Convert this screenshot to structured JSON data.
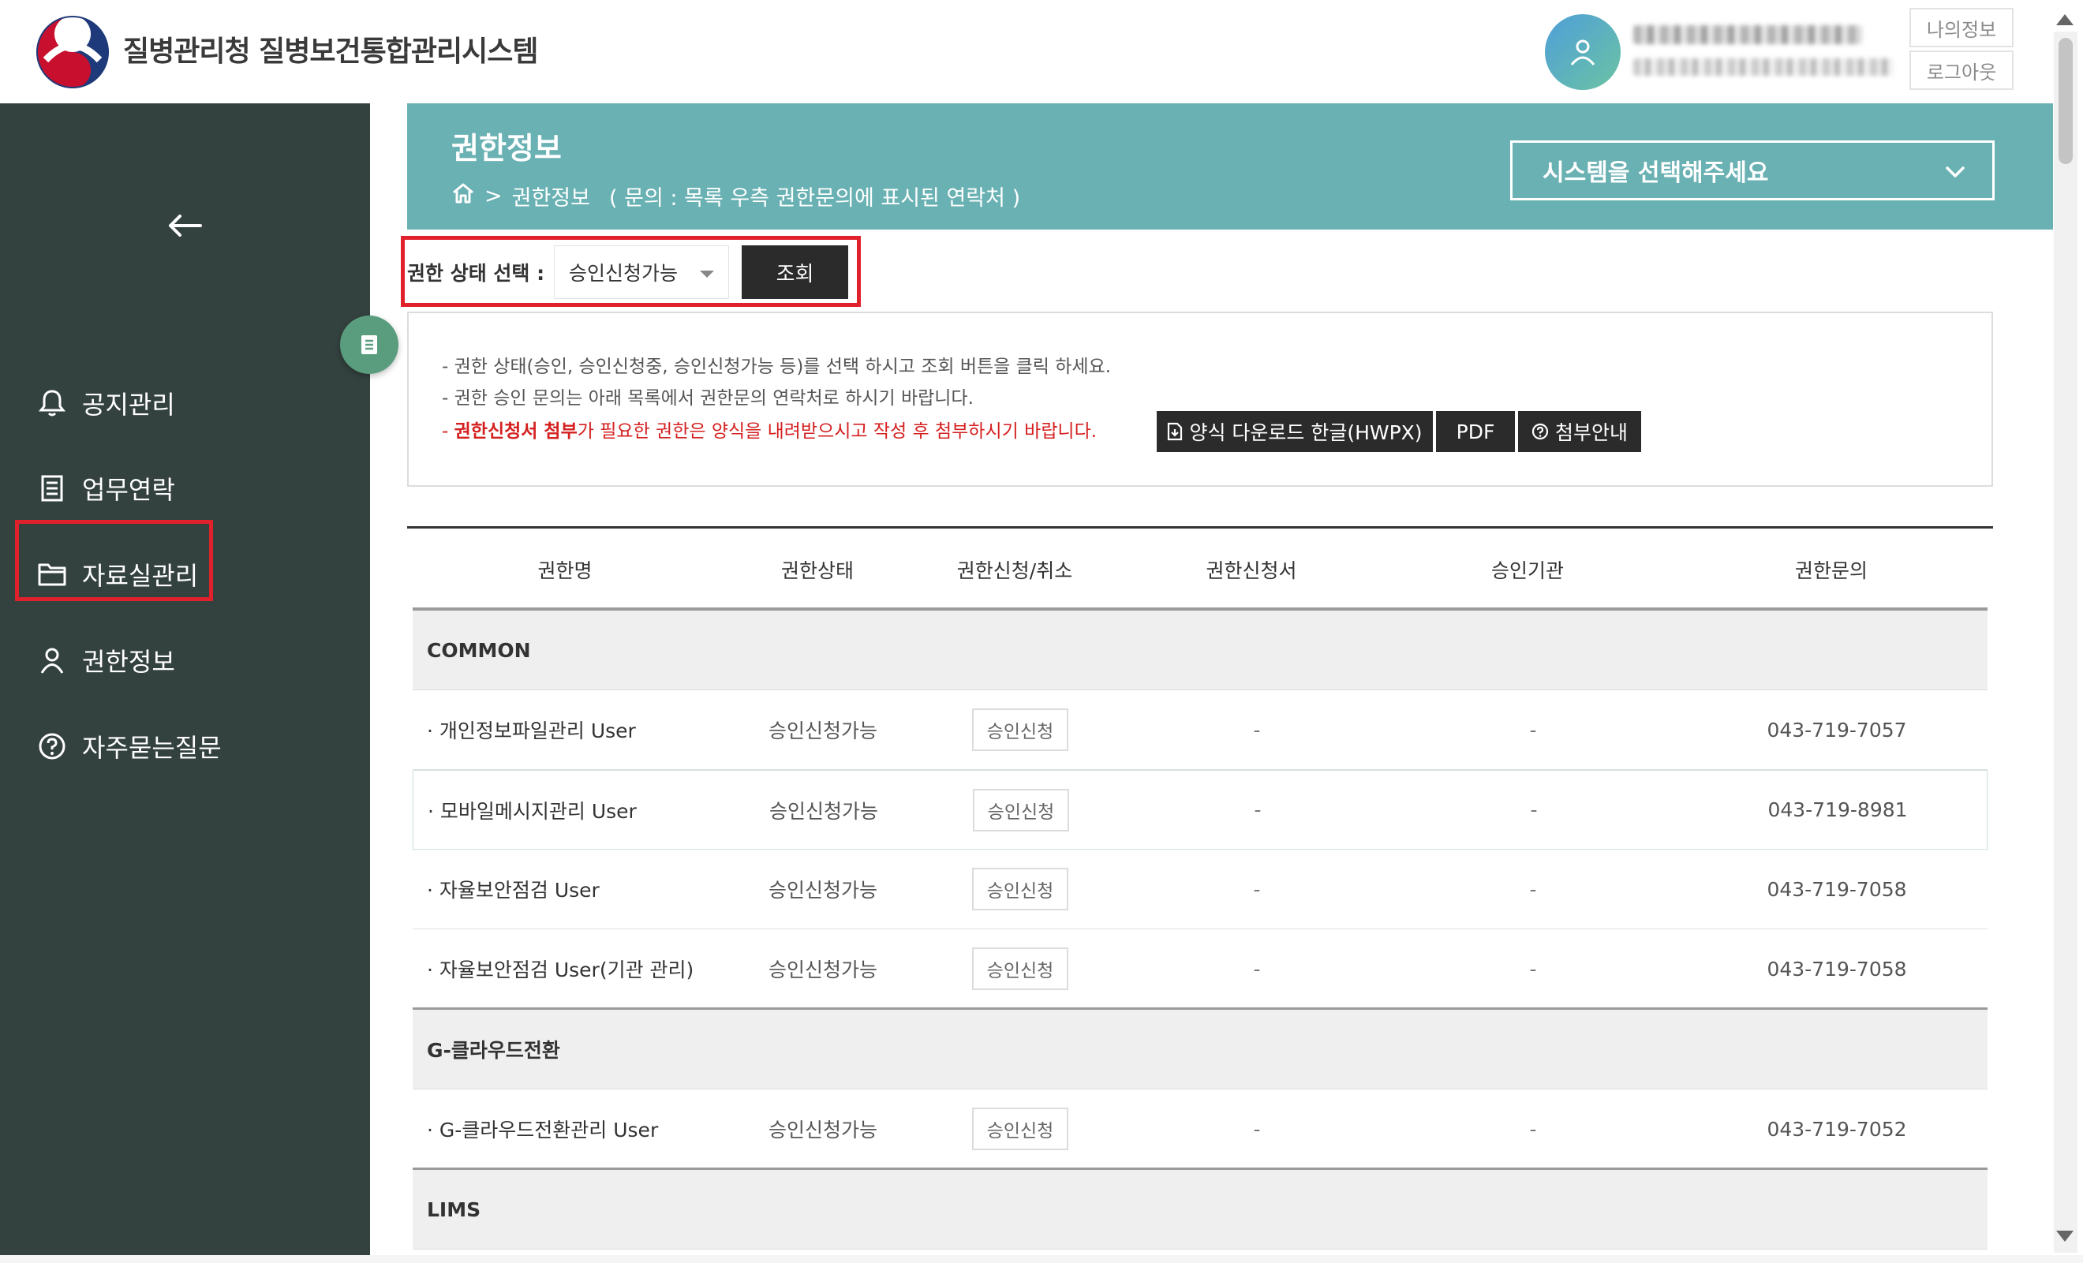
{
  "header": {
    "app_title": "질병관리청 질병보건통합관리시스템",
    "my_info_label": "나의정보",
    "logout_label": "로그아웃"
  },
  "sidebar": {
    "items": [
      {
        "label": "공지관리",
        "icon": "bell-icon"
      },
      {
        "label": "업무연락",
        "icon": "document-icon"
      },
      {
        "label": "자료실관리",
        "icon": "folder-icon"
      },
      {
        "label": "권한정보",
        "icon": "person-icon"
      },
      {
        "label": "자주묻는질문",
        "icon": "question-circle-icon"
      }
    ],
    "active_index": 3
  },
  "banner": {
    "title": "권한정보",
    "breadcrumb_sep": ">",
    "breadcrumb_current": "권한정보",
    "breadcrumb_note": "( 문의 : 목록 우측 권한문의에 표시된 연락처 )",
    "system_select_placeholder": "시스템을 선택해주세요"
  },
  "filter": {
    "label": "권한 상태 선택 :",
    "selected": "승인신청가능",
    "search_label": "조회"
  },
  "info": {
    "line1": "- 권한 상태(승인, 승인신청중, 승인신청가능 등)를 선택 하시고 조회 버튼을 클릭 하세요.",
    "line2": "- 권한 승인 문의는 아래 목록에서 권한문의 연락처로 하시기 바랍니다.",
    "line3_prefix": "- ",
    "line3_bold": "권한신청서 첨부",
    "line3_rest": "가 필요한 권한은 양식을 내려받으시고 작성 후 첨부하시기 바랍니다.",
    "download_hwpx_label": "양식 다운로드 한글(HWPX)",
    "download_pdf_label": "PDF",
    "guide_label": "첨부안내"
  },
  "table": {
    "headers": [
      "권한명",
      "권한상태",
      "권한신청/취소",
      "권한신청서",
      "승인기관",
      "권한문의"
    ],
    "groups": [
      {
        "name": "COMMON",
        "rows": [
          {
            "name": "· 개인정보파일관리 User",
            "status": "승인신청가능",
            "apply": "승인신청",
            "form": "-",
            "agency": "-",
            "contact": "043-719-7057"
          },
          {
            "name": "· 모바일메시지관리 User",
            "status": "승인신청가능",
            "apply": "승인신청",
            "form": "-",
            "agency": "-",
            "contact": "043-719-8981"
          },
          {
            "name": "· 자율보안점검 User",
            "status": "승인신청가능",
            "apply": "승인신청",
            "form": "-",
            "agency": "-",
            "contact": "043-719-7058"
          },
          {
            "name": "· 자율보안점검 User(기관 관리)",
            "status": "승인신청가능",
            "apply": "승인신청",
            "form": "-",
            "agency": "-",
            "contact": "043-719-7058"
          }
        ]
      },
      {
        "name": "G-클라우드전환",
        "rows": [
          {
            "name": "· G-클라우드전환관리 User",
            "status": "승인신청가능",
            "apply": "승인신청",
            "form": "-",
            "agency": "-",
            "contact": "043-719-7052"
          }
        ]
      },
      {
        "name": "LIMS",
        "rows": []
      }
    ]
  },
  "colors": {
    "sidebar_bg": "#33413f",
    "banner_bg": "#6ab1b3",
    "highlight_red": "#e0202b",
    "dark_button": "#2b2b2b",
    "toggle_green": "#5a9d7e"
  }
}
